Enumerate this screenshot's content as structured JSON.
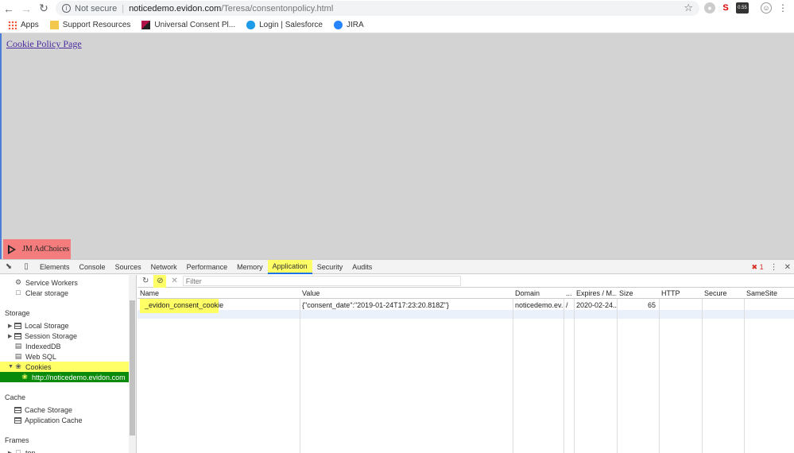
{
  "browser": {
    "url_security": "Not secure",
    "url_host": "noticedemo.evidon.com",
    "url_path": "/Teresa/consentonpolicy.html",
    "extension_badge": "0.55"
  },
  "bookmarks": [
    {
      "label": "Apps"
    },
    {
      "label": "Support Resources"
    },
    {
      "label": "Universal Consent Pl..."
    },
    {
      "label": "Login | Salesforce"
    },
    {
      "label": "JIRA"
    }
  ],
  "page": {
    "link_text": "Cookie Policy Page",
    "adchoices_label": "JM AdChoices"
  },
  "devtools": {
    "tabs": [
      "Elements",
      "Console",
      "Sources",
      "Network",
      "Performance",
      "Memory",
      "Application",
      "Security",
      "Audits"
    ],
    "active_tab": "Application",
    "error_count": "1",
    "filter_placeholder": "Filter",
    "sidebar": {
      "top_items": [
        "Service Workers",
        "Clear storage"
      ],
      "storage_header": "Storage",
      "storage_items": [
        "Local Storage",
        "Session Storage",
        "IndexedDB",
        "Web SQL",
        "Cookies"
      ],
      "cookie_origin": "http://noticedemo.evidon.com",
      "cache_header": "Cache",
      "cache_items": [
        "Cache Storage",
        "Application Cache"
      ],
      "frames_header": "Frames",
      "frames_item": "top"
    },
    "table": {
      "columns": [
        "Name",
        "Value",
        "Domain",
        "...",
        "Expires / M...",
        "Size",
        "HTTP",
        "Secure",
        "SameSite"
      ],
      "rows": [
        {
          "name": "_evidon_consent_cookie",
          "value": "{\"consent_date\":\"2019-01-24T17:23:20.818Z\"}",
          "domain": "noticedemo.ev...",
          "path": "/",
          "expires": "2020-02-24...",
          "size": "65",
          "http": "",
          "secure": "",
          "samesite": ""
        }
      ]
    }
  },
  "colors": {
    "highlight": "#ffff66",
    "selected": "#0a8a0a",
    "adchoices_bg": "#f47c7c",
    "page_bg": "#d3d3d3"
  }
}
